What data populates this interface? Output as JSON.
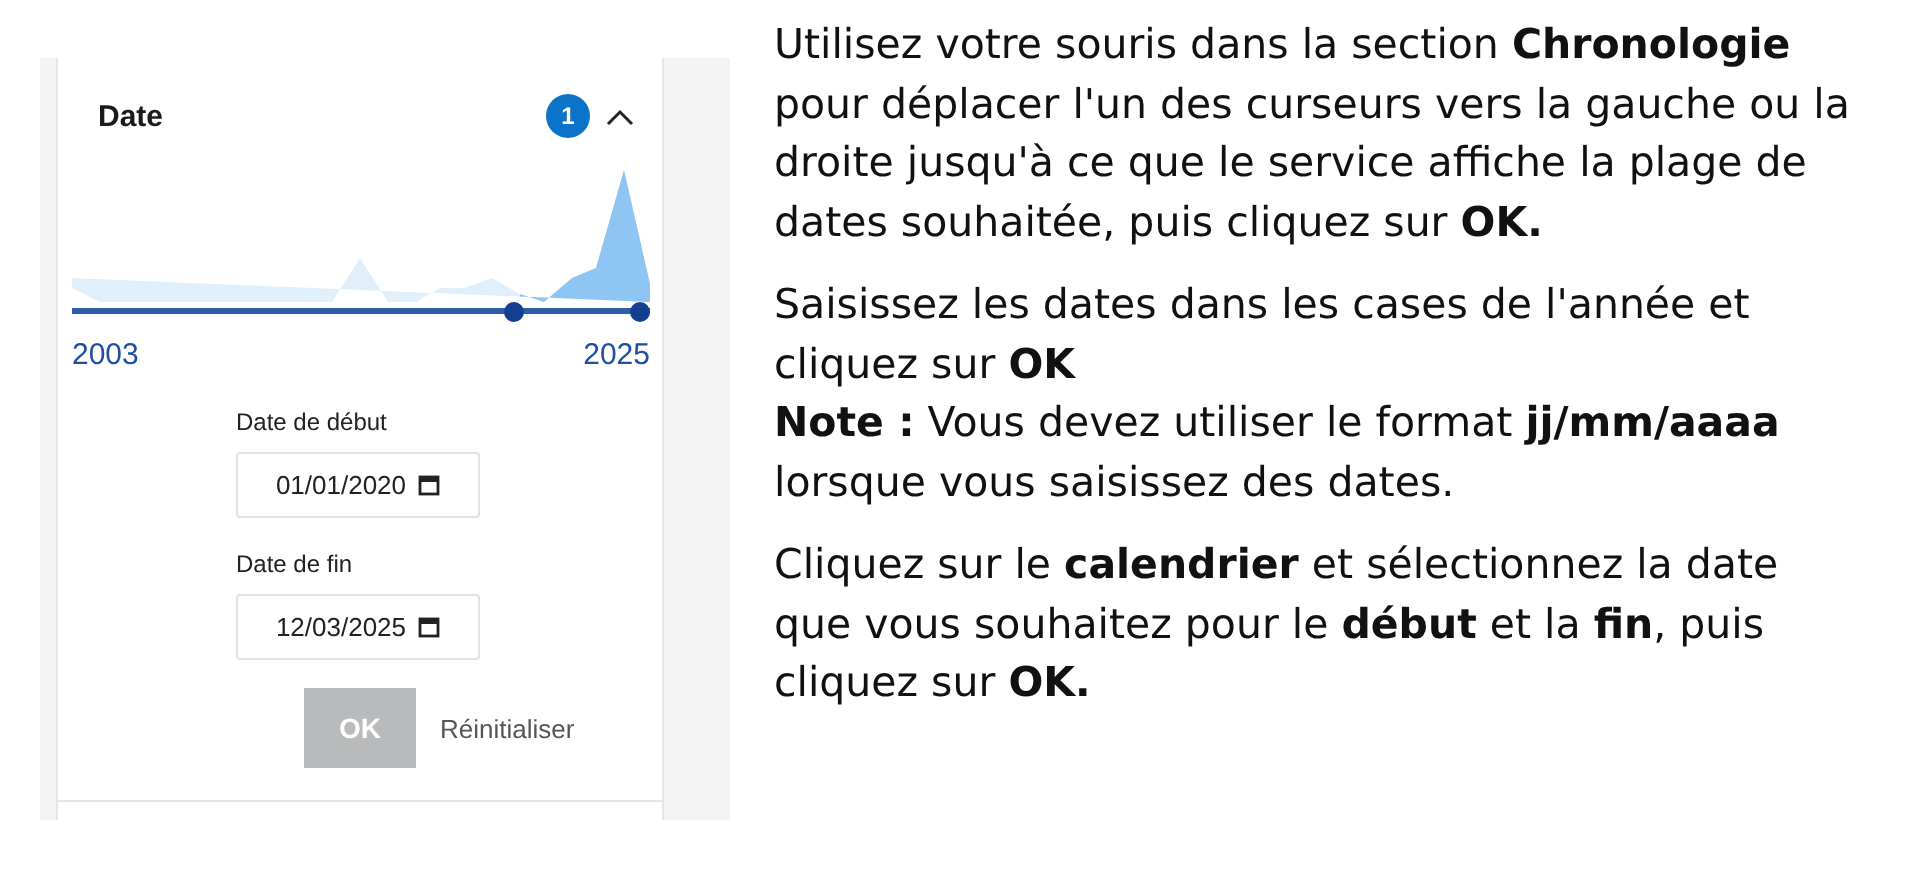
{
  "filter": {
    "title": "Date",
    "badge": "1",
    "expanded": true,
    "timeline": {
      "start_label": "2003",
      "end_label": "2025",
      "handles": [
        {
          "level": 0.775
        },
        {
          "level": 1
        }
      ]
    },
    "fields": [
      {
        "label": "Date de début",
        "value": "01/01/2020"
      },
      {
        "label": "Date de fin",
        "value": "12/03/2025"
      }
    ],
    "buttons": [
      {
        "label": "OK",
        "kind": "primary",
        "disabled": true
      },
      {
        "label": "Réinitialiser",
        "kind": "link",
        "disabled": false
      }
    ]
  },
  "instructions": [
    {
      "lines": [
        "Utilisez votre souris dans la section **Chronologie** pour déplacer l'un des curseurs vers la gauche ou la droite jusqu'à ce que le service affiche la plage de dates souhaitée, puis cliquez sur **OK.**"
      ]
    },
    {
      "lines": [
        "Saisissez les dates dans les cases de l'année et cliquez sur **OK**",
        "**Note :** Vous devez utiliser le format **jj/mm/aaaa** lorsque vous saisissez des dates."
      ]
    },
    {
      "lines": [
        "Cliquez sur le **calendrier** et sélectionnez la date que vous souhaitez pour le **début** et la **fin**, puis cliquez sur **OK.**"
      ]
    }
  ]
}
